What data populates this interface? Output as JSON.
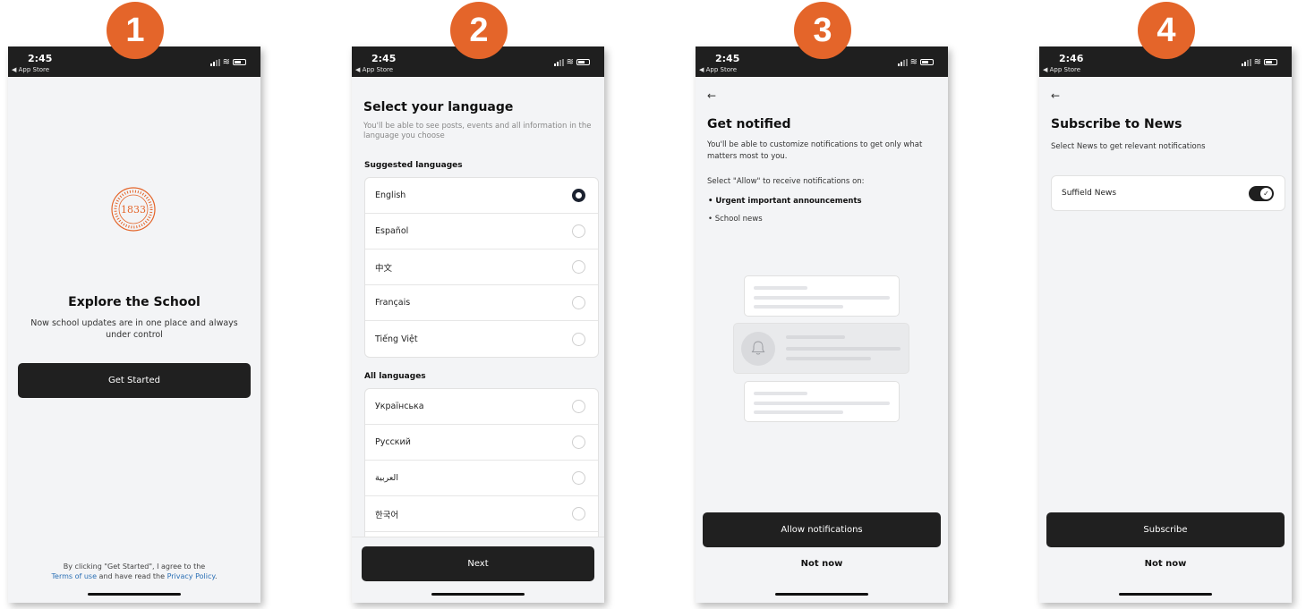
{
  "badges": [
    "1",
    "2",
    "3",
    "4"
  ],
  "status_icons": [
    "signal-icon",
    "wifi-icon",
    "battery-icon"
  ],
  "colors": {
    "badge": "#e4652a",
    "dark_button": "#202020",
    "status_bar": "#1f1f1f",
    "link": "#2a6fb5"
  },
  "screen1": {
    "status": {
      "time": "2:45",
      "back": "◀ App Store"
    },
    "logo_text": "1833",
    "title": "Explore the School",
    "subtitle": "Now school updates are in one place and always under control",
    "cta": "Get Started",
    "legal": {
      "line1": "By clicking \"Get Started\", I agree to the",
      "terms": "Terms of use",
      "middle": " and have read the ",
      "privacy": "Privacy Policy",
      "end": "."
    }
  },
  "screen2": {
    "status": {
      "time": "2:45",
      "back": "◀ App Store"
    },
    "title": "Select your language",
    "subtitle": "You'll be able to see posts, events and all information in the language you choose",
    "suggested_label": "Suggested languages",
    "suggested": [
      "English",
      "Español",
      "中文",
      "Français",
      "Tiếng Việt"
    ],
    "selected": "English",
    "all_label": "All languages",
    "all": [
      "Українська",
      "Русский",
      "العربية",
      "한국어"
    ],
    "cta": "Next"
  },
  "screen3": {
    "status": {
      "time": "2:45",
      "back": "◀ App Store"
    },
    "back_icon": "arrow-left-icon",
    "title": "Get notified",
    "p1": "You'll be able to customize notifications to get only what matters most to you.",
    "p2": "Select \"Allow\" to receive notifications on:",
    "bullets": [
      "Urgent important announcements",
      "School news"
    ],
    "illustration_icon": "bell-icon",
    "cta": "Allow notifications",
    "secondary": "Not now"
  },
  "screen4": {
    "status": {
      "time": "2:46",
      "back": "◀ App Store"
    },
    "back_icon": "arrow-left-icon",
    "title": "Subscribe to News",
    "subtitle": "Select News to get relevant notifications",
    "toggle_label": "Suffield News",
    "toggle_on": true,
    "cta": "Subscribe",
    "secondary": "Not now"
  }
}
